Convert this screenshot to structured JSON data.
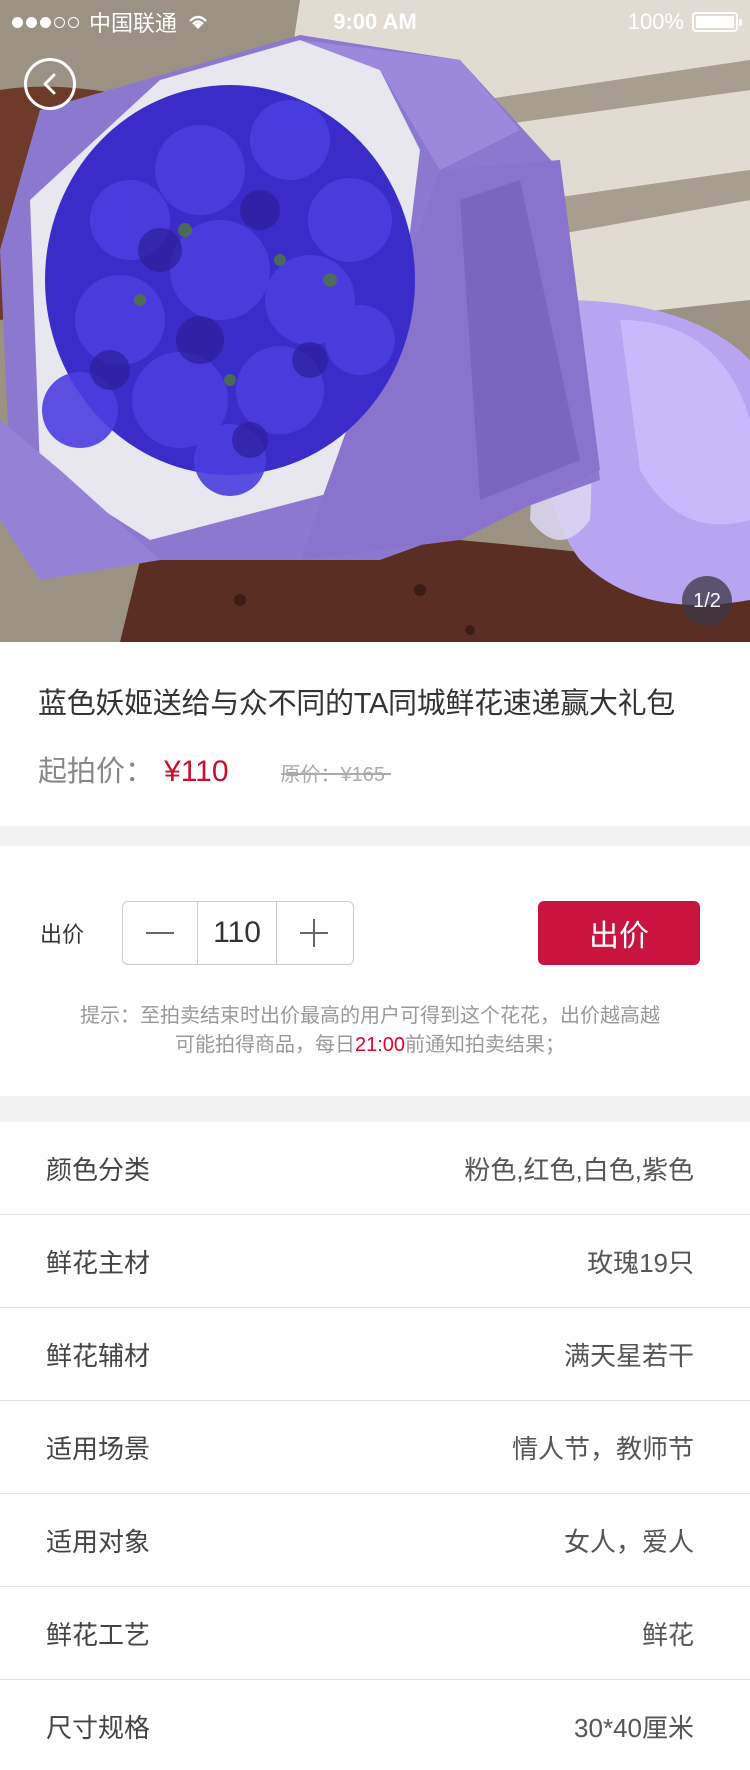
{
  "status_bar": {
    "carrier": "中国联通",
    "time": "9:00 AM",
    "battery": "100%"
  },
  "gallery": {
    "pager": "1/2"
  },
  "product": {
    "title": "蓝色妖姬送给与众不同的TA同城鲜花速递赢大礼包",
    "price_label": "起拍价：",
    "price": "¥110",
    "original_price": "原价：¥165"
  },
  "bid": {
    "label": "出价",
    "amount": "110",
    "button": "出价",
    "tip_part1": "提示：至拍卖结束时出价最高的用户可得到这个花花，出价越高越",
    "tip_part2": "可能拍得商品，每日",
    "tip_time": "21:00",
    "tip_part3": "前通知拍卖结果；"
  },
  "specs": [
    {
      "key": "颜色分类",
      "value": "粉色,红色,白色,紫色"
    },
    {
      "key": "鲜花主材",
      "value": "玫瑰19只"
    },
    {
      "key": "鲜花辅材",
      "value": "满天星若干"
    },
    {
      "key": "适用场景",
      "value": "情人节，教师节"
    },
    {
      "key": "适用对象",
      "value": "女人，爱人"
    },
    {
      "key": "鲜花工艺",
      "value": "鲜花"
    },
    {
      "key": "尺寸规格",
      "value": "30*40厘米"
    }
  ],
  "colors": {
    "accent": "#c8143f",
    "price": "#c8102e",
    "highlight": "#e4002b"
  },
  "icons": [
    "back-arrow-icon",
    "wifi-icon",
    "battery-icon",
    "minus-icon",
    "plus-icon"
  ]
}
